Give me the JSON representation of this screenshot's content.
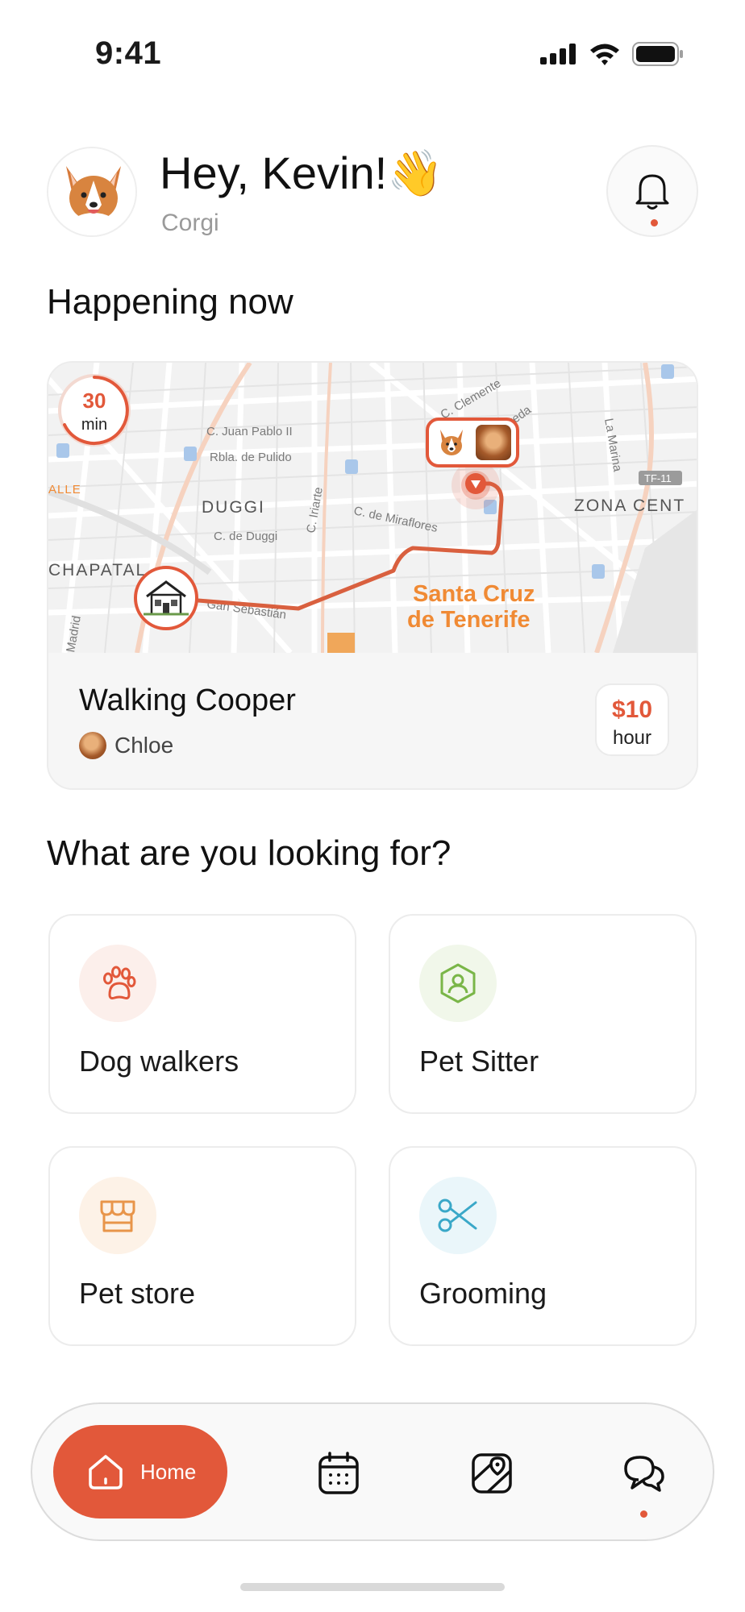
{
  "status_bar": {
    "time": "9:41"
  },
  "header": {
    "greeting": "Hey, Kevin!👋",
    "subtitle": "Corgi"
  },
  "happening": {
    "section_title": "Happening now",
    "timer_value": "30",
    "timer_unit": "min",
    "map_labels": {
      "street_1": "C. Juan Pablo II",
      "street_2": "Rbla. de Pulido",
      "district": "DUGGI",
      "street_3": "C. de Duggi",
      "street_4": "C. de Miraflores",
      "street_5": "C. Iriarte",
      "street_6": "Gan Sebastián",
      "street_7": "C. Clemente",
      "street_8": "La Marina",
      "street_9": "Aveda",
      "street_10": "Madrid",
      "zone": "ZONA CENT",
      "left_district": "CHAPATAL",
      "left_edge": "ALLE",
      "road_sign": "TF-11",
      "city_line1": "Santa Cruz",
      "city_line2": "de Tenerife"
    },
    "walk_title": "Walking Cooper",
    "walker_name": "Chloe",
    "price_value": "$10",
    "price_unit": "hour"
  },
  "categories": {
    "section_title": "What are you looking for?",
    "items": [
      {
        "label": "Dog walkers",
        "icon": "paw-icon",
        "color": "#e2583a",
        "bg": "#fcefeb"
      },
      {
        "label": "Pet Sitter",
        "icon": "sitter-shield-icon",
        "color": "#7ab648",
        "bg": "#f1f7ea"
      },
      {
        "label": "Pet store",
        "icon": "store-icon",
        "color": "#e8954a",
        "bg": "#fdf2e7"
      },
      {
        "label": "Grooming",
        "icon": "scissors-icon",
        "color": "#3aa8c8",
        "bg": "#eaf6fa"
      }
    ]
  },
  "nav": {
    "home_label": "Home",
    "items": [
      "home-icon",
      "calendar-icon",
      "map-icon",
      "chat-icon"
    ]
  },
  "colors": {
    "accent": "#e2583a",
    "route": "#d9603f",
    "city_label": "#f08a34"
  }
}
